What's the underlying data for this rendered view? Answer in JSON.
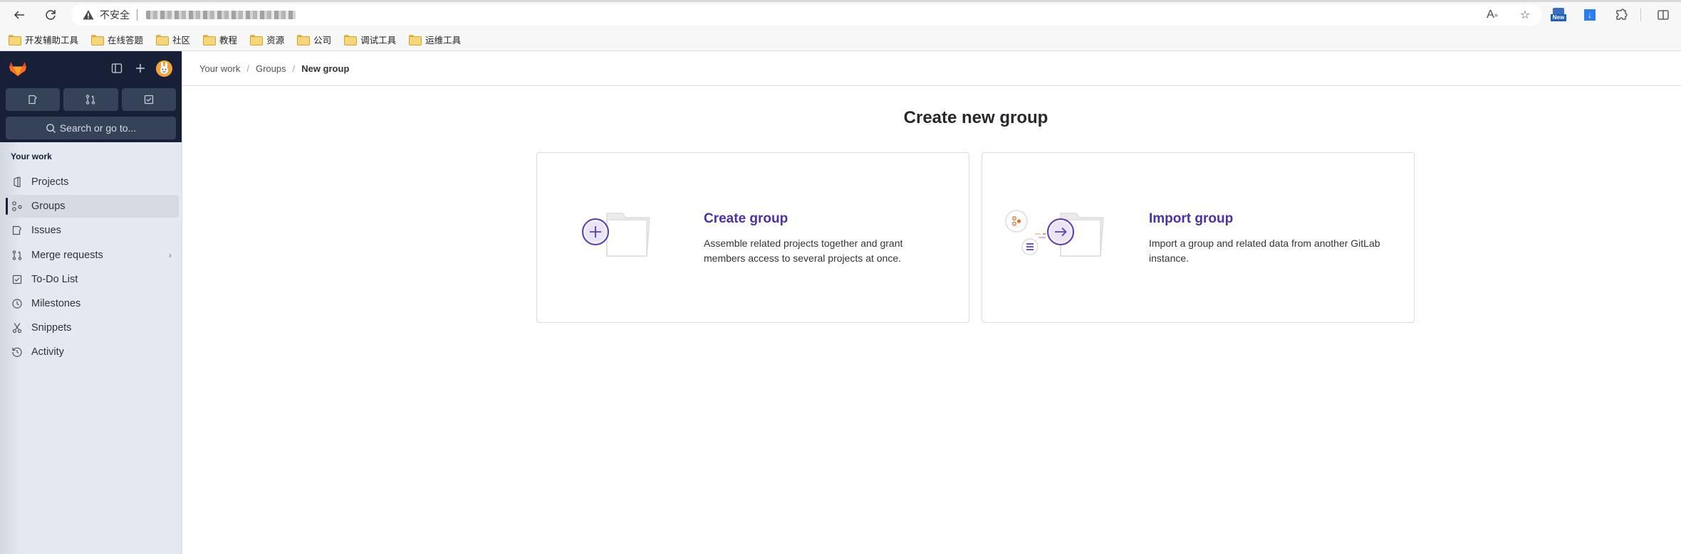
{
  "browser": {
    "security_label": "不安全",
    "url": "",
    "extension_new_label": "New",
    "bookmarks": [
      "开发辅助工具",
      "在线答题",
      "社区",
      "教程",
      "资源",
      "公司",
      "调试工具",
      "运维工具"
    ]
  },
  "sidebar": {
    "counts": [
      {
        "icon": "issues-icon",
        "label": "Issues"
      },
      {
        "icon": "merge-request-icon",
        "label": "Merge requests"
      },
      {
        "icon": "todo-icon",
        "label": "To-Do List"
      }
    ],
    "search_label": "Search or go to...",
    "section_title": "Your work",
    "items": [
      {
        "label": "Projects",
        "icon": "project-icon",
        "active": false
      },
      {
        "label": "Groups",
        "icon": "group-icon",
        "active": true
      },
      {
        "label": "Issues",
        "icon": "issues-icon",
        "active": false
      },
      {
        "label": "Merge requests",
        "icon": "merge-request-icon",
        "active": false,
        "has_submenu": true
      },
      {
        "label": "To-Do List",
        "icon": "todo-icon",
        "active": false
      },
      {
        "label": "Milestones",
        "icon": "clock-icon",
        "active": false
      },
      {
        "label": "Snippets",
        "icon": "snippet-icon",
        "active": false
      },
      {
        "label": "Activity",
        "icon": "history-icon",
        "active": false
      }
    ]
  },
  "breadcrumb": {
    "items": [
      "Your work",
      "Groups",
      "New group"
    ]
  },
  "main": {
    "title": "Create new group",
    "cards": [
      {
        "title": "Create group",
        "description": "Assemble related projects together and grant members access to several projects at once."
      },
      {
        "title": "Import group",
        "description": "Import a group and related data from another GitLab instance."
      }
    ]
  },
  "colors": {
    "sidebar_dark": "#172036",
    "sidebar_light": "#e4e8f0",
    "accent_purple": "#4d2fae",
    "gitlab_orange": "#e24329"
  }
}
